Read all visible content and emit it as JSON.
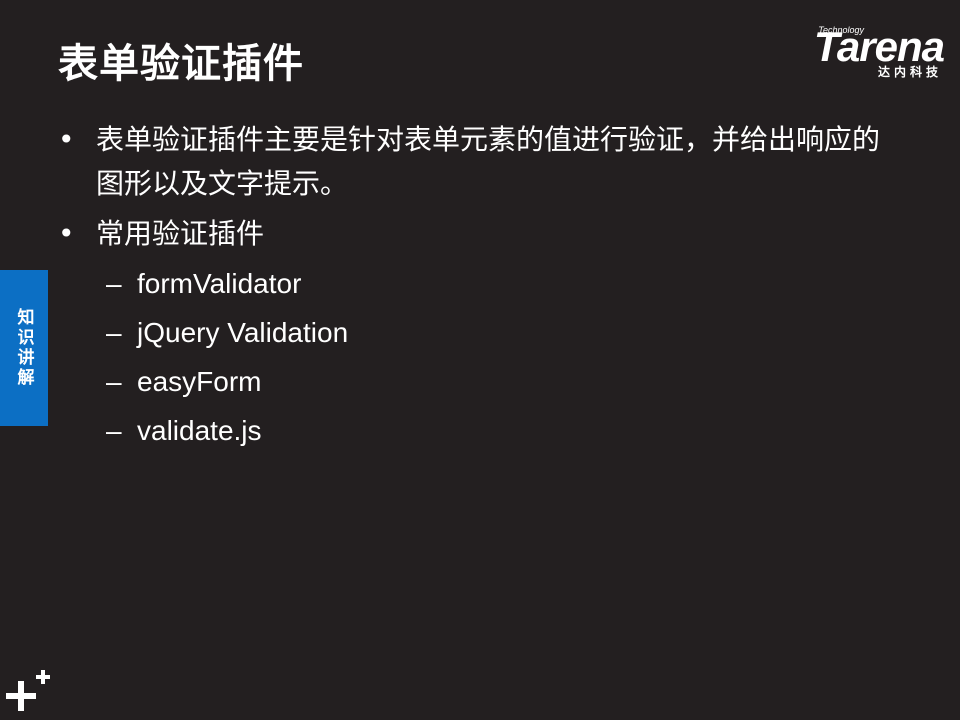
{
  "slide": {
    "title": "表单验证插件",
    "bullets": [
      {
        "mark": "•",
        "text": "表单验证插件主要是针对表单元素的值进行验证，并给出响应的图形以及文字提示。"
      },
      {
        "mark": "•",
        "text": "常用验证插件"
      }
    ],
    "sub_items": [
      {
        "mark": "–",
        "text": "formValidator"
      },
      {
        "mark": "–",
        "text": "jQuery Validation"
      },
      {
        "mark": "–",
        "text": "easyForm"
      },
      {
        "mark": "–",
        "text": "validate.js"
      }
    ]
  },
  "logo": {
    "tagline": "Technology",
    "wordmark": "Tarena",
    "chinese": "达内科技"
  },
  "side_tab": {
    "label": "知识讲解",
    "color": "#0c6fc4"
  },
  "corner_icon": "plus-plus-icon",
  "colors": {
    "background": "#231f20",
    "text": "#ffffff",
    "accent": "#0c6fc4"
  }
}
